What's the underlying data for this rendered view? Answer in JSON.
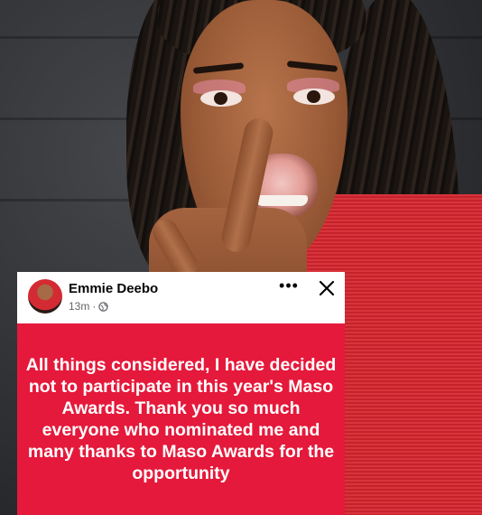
{
  "post": {
    "author": "Emmie Deebo",
    "time": "13m",
    "separator": "·",
    "more_label": "•••",
    "text": "All things considered, I have decided not to participate in this year's Maso Awards. Thank you so much everyone who nominated me and many thanks to Maso Awards for the opportunity",
    "background_color": "#e5193b"
  },
  "icons": {
    "privacy": "globe-icon",
    "more": "more-options-icon",
    "close": "close-icon"
  }
}
